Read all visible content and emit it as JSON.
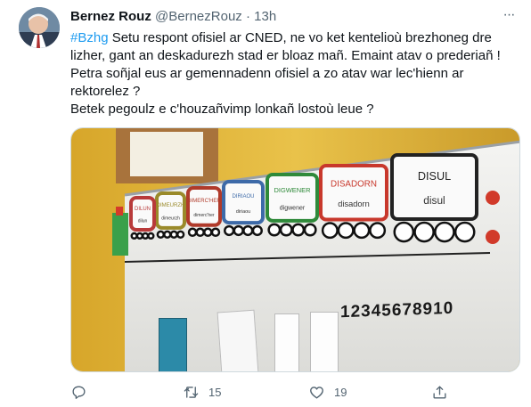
{
  "tweet": {
    "author_name": "Bernez Rouz",
    "handle": "@BernezRouz",
    "separator": "·",
    "time": "13h",
    "more_label": "···",
    "hashtag": "#Bzhg",
    "lines": [
      " Setu respont ofisiel ar CNED, ne vo ket kentelioù brezhoneg dre",
      "lizher, gant an deskadurezh stad er bloaz mañ. Emaint atav o prederiañ !",
      "Petra soñjal eus ar gemennadenn ofisiel a zo atav war lec'hienn ar",
      "rektorelez ?",
      "Betek pegoulz e c'houzañvimp lonkañ lostoù  leue ?"
    ]
  },
  "media": {
    "train_cars": [
      "DISUL",
      "DISADORN",
      "DIGWENER",
      "DIRIAOU",
      "DIMERC'HER",
      "DIMEURZH",
      "DILUN"
    ],
    "train_cars_lower": [
      "disul",
      "disadorn",
      "digwener",
      "diriaou",
      "dimerc'her",
      "dimeurzh",
      "dilun"
    ],
    "number_strip": "12345678910"
  },
  "actions": {
    "reply_count": "",
    "retweet_count": "15",
    "like_count": "19"
  },
  "icons": [
    "more-icon",
    "reply-icon",
    "retweet-icon",
    "like-icon",
    "share-icon"
  ],
  "colors": {
    "hashtag": "#1d9bf0",
    "muted": "#536471",
    "text": "#0f1419"
  }
}
